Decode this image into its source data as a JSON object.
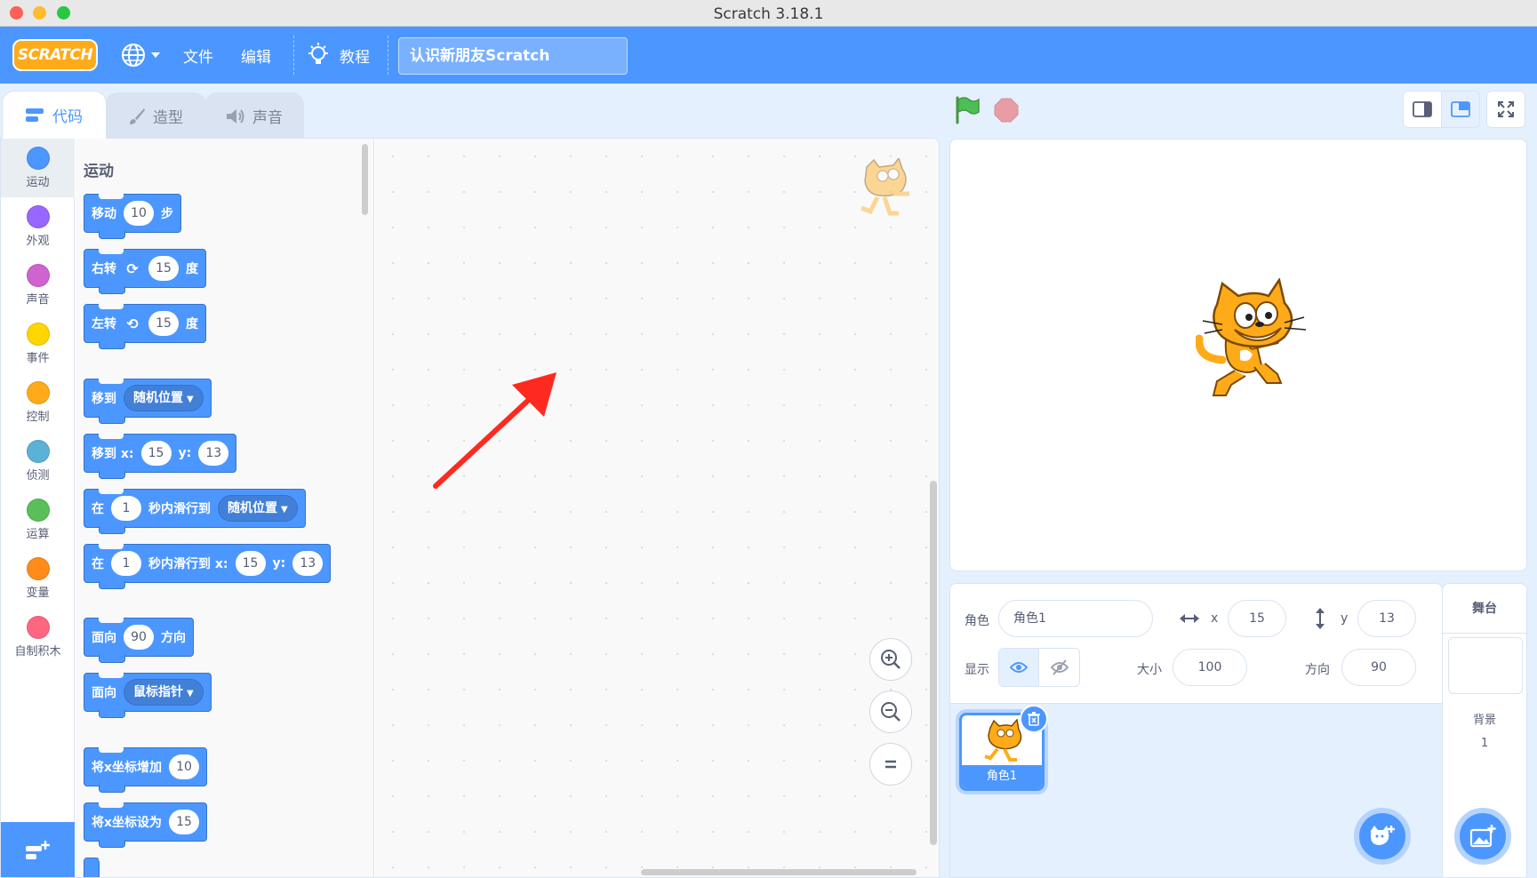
{
  "window": {
    "title": "Scratch 3.18.1"
  },
  "menubar": {
    "logo": "SCRATCH",
    "file": "文件",
    "edit": "编辑",
    "tutorials": "教程",
    "project_title": "认识新朋友Scratch"
  },
  "tabs": [
    {
      "label": "代码",
      "icon": "code-icon",
      "active": true
    },
    {
      "label": "造型",
      "icon": "brush-icon",
      "active": false
    },
    {
      "label": "声音",
      "icon": "speaker-icon",
      "active": false
    }
  ],
  "categories": [
    {
      "label": "运动",
      "color": "#4c97ff"
    },
    {
      "label": "外观",
      "color": "#9966ff"
    },
    {
      "label": "声音",
      "color": "#cf63cf"
    },
    {
      "label": "事件",
      "color": "#ffd500"
    },
    {
      "label": "控制",
      "color": "#ffab19"
    },
    {
      "label": "侦测",
      "color": "#5cb1d6"
    },
    {
      "label": "运算",
      "color": "#59c059"
    },
    {
      "label": "变量",
      "color": "#ff8c1a"
    },
    {
      "label": "自制积木",
      "color": "#ff6680"
    }
  ],
  "flyout": {
    "title": "运动",
    "blocks": {
      "move": {
        "a": "移动",
        "v": "10",
        "b": "步"
      },
      "turn_right": {
        "a": "右转",
        "v": "15",
        "b": "度"
      },
      "turn_left": {
        "a": "左转",
        "v": "15",
        "b": "度"
      },
      "goto": {
        "a": "移到",
        "d": "随机位置"
      },
      "goto_xy": {
        "a": "移到 x:",
        "x": "15",
        "yl": "y:",
        "y": "13"
      },
      "glide": {
        "a": "在",
        "v": "1",
        "b": "秒内滑行到",
        "d": "随机位置"
      },
      "glide_xy": {
        "a": "在",
        "v": "1",
        "b": "秒内滑行到 x:",
        "x": "15",
        "yl": "y:",
        "y": "13"
      },
      "point_dir": {
        "a": "面向",
        "v": "90",
        "b": "方向"
      },
      "point_towards": {
        "a": "面向",
        "d": "鼠标指针"
      },
      "change_x": {
        "a": "将x坐标增加",
        "v": "10"
      },
      "set_x": {
        "a": "将x坐标设为",
        "v": "15"
      }
    }
  },
  "sprite_info": {
    "sprite_label": "角色",
    "sprite_name": "角色1",
    "x_label": "x",
    "x": "15",
    "y_label": "y",
    "y": "13",
    "show_label": "显示",
    "size_label": "大小",
    "size": "100",
    "direction_label": "方向",
    "direction": "90"
  },
  "sprites": [
    {
      "name": "角色1"
    }
  ],
  "stage_panel": {
    "title": "舞台",
    "backdrop_label": "背景",
    "backdrop_count": "1"
  },
  "colors": {
    "primary": "#4c97ff",
    "accent": "#ffab19",
    "flag": "#4cbf56",
    "stop": "#ec5959",
    "arrow": "#ff2a1f"
  }
}
